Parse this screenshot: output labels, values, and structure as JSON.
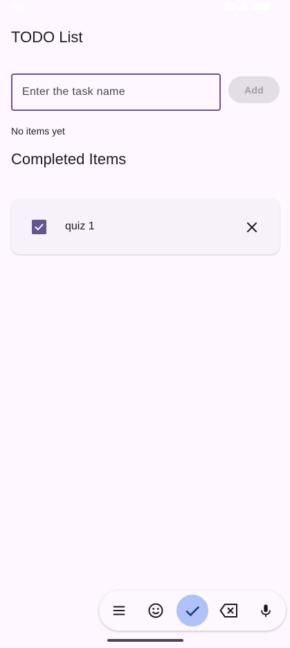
{
  "status_bar": {
    "time": "9:00"
  },
  "page": {
    "title": "TODO List"
  },
  "task_input": {
    "placeholder": "Enter the task name",
    "value": ""
  },
  "add_button": {
    "label": "Add",
    "enabled": false
  },
  "todo_list": {
    "empty_text": "No items yet"
  },
  "completed": {
    "section_title": "Completed Items",
    "items": [
      {
        "label": "quiz 1",
        "checked": true
      }
    ]
  },
  "keyboard_toolbar": {
    "buttons": [
      {
        "icon": "menu-icon"
      },
      {
        "icon": "emoji-icon"
      },
      {
        "icon": "check-icon",
        "active": true
      },
      {
        "icon": "backspace-icon"
      },
      {
        "icon": "microphone-icon"
      }
    ]
  },
  "colors": {
    "background": "#fef7ff",
    "accent": "#65558f",
    "card": "#f7f2fa",
    "active_key": "#b0c2f7"
  }
}
